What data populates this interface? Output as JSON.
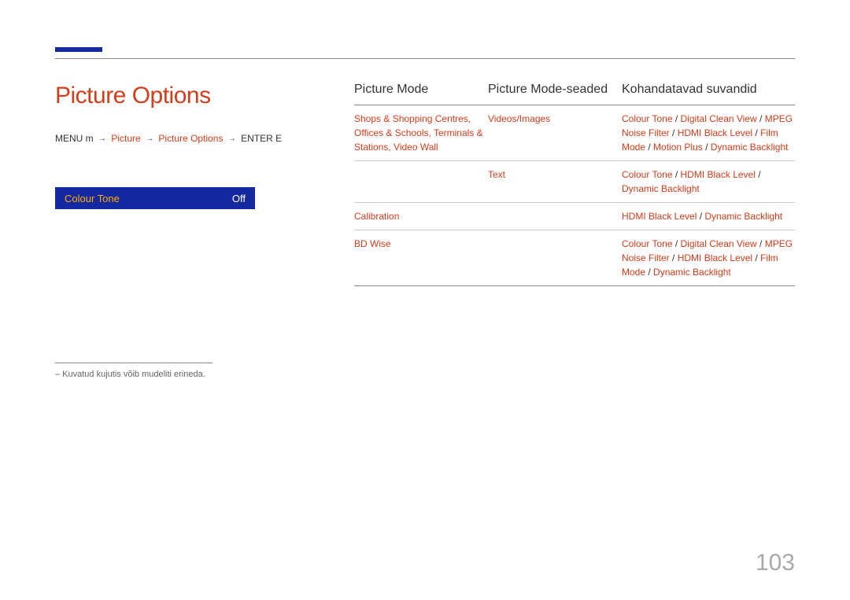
{
  "title": "Picture Options",
  "breadcrumb": {
    "prefix": "MENU m",
    "parts": [
      "Picture",
      "Picture Options"
    ],
    "suffix": "ENTER E"
  },
  "menu": {
    "label": "Colour Tone",
    "value": "Off"
  },
  "footnote": "–   Kuvatud kujutis võib mudeliti erineda.",
  "headers": [
    "Picture Mode",
    "Picture Mode-seaded",
    "Kohandatavad suvandid"
  ],
  "rows": [
    {
      "c1": "Shops & Shopping Centres, Offices & Schools, Terminals & Stations, Video Wall",
      "c2": "Videos/Images",
      "c3": [
        "Colour Tone",
        "Digital Clean View",
        "MPEG Noise Filter",
        "HDMI Black Level",
        "Film Mode",
        "Motion Plus",
        "Dynamic Backlight"
      ]
    },
    {
      "c1": "",
      "c2": "Text",
      "c3": [
        "Colour Tone",
        "HDMI Black Level",
        "Dynamic Backlight"
      ]
    },
    {
      "c1": "Calibration",
      "c2": "",
      "c3": [
        "HDMI Black Level",
        "Dynamic Backlight"
      ]
    },
    {
      "c1": "BD Wise",
      "c2": "",
      "c3": [
        "Colour Tone",
        "Digital Clean View",
        "MPEG Noise Filter",
        "HDMI Black Level",
        "Film Mode",
        "Dynamic Backlight"
      ]
    }
  ],
  "pageNumber": "103"
}
